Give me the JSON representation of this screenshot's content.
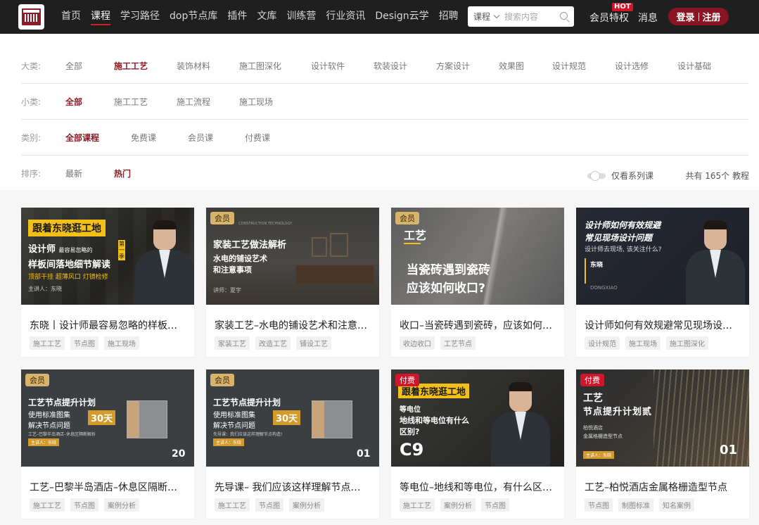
{
  "header": {
    "logo_text": "",
    "nav": [
      "首页",
      "课程",
      "学习路径",
      "dop节点库",
      "插件",
      "文库",
      "训练营",
      "行业资讯",
      "Design云学",
      "招聘"
    ],
    "active_nav": 1,
    "search": {
      "category": "课程",
      "placeholder": "搜索内容"
    },
    "member_label": "会员特权",
    "hot_badge": "HOT",
    "message_label": "消息",
    "login_label": "登录",
    "register_label": "注册"
  },
  "filters": {
    "major": {
      "label": "大类:",
      "options": [
        "全部",
        "施工工艺",
        "装饰材料",
        "施工图深化",
        "设计软件",
        "软装设计",
        "方案设计",
        "效果图",
        "设计规范",
        "设计选修",
        "设计基础"
      ],
      "selected": 1
    },
    "minor": {
      "label": "小类:",
      "options": [
        "全部",
        "施工工艺",
        "施工流程",
        "施工现场"
      ],
      "selected": 0
    },
    "kind": {
      "label": "类别:",
      "options": [
        "全部课程",
        "免费课",
        "会员课",
        "付费课"
      ],
      "selected": 0
    },
    "sort": {
      "label": "排序:",
      "options": [
        "最新",
        "热门"
      ],
      "selected": 1
    },
    "series_only_label": "仅看系列课",
    "total_prefix": "共有 ",
    "total_count": "165",
    "total_suffix": "个 教程"
  },
  "courses": [
    {
      "title": "东晓丨设计师最容易忽略的样板…",
      "tags": [
        "施工工艺",
        "节点图",
        "施工现场"
      ],
      "badge": "",
      "thumb": {
        "line1": "跟着东晓逛工地",
        "line2": "设计师",
        "line2b": "最容易忽略的",
        "line3": "样板间落地细节解读",
        "line4": "顶部干挂  超薄风口  灯镜检修",
        "line5": "主讲人：东晓",
        "seal": "第一季"
      }
    },
    {
      "title": "家装工艺–水电的铺设艺术和注意…",
      "tags": [
        "家装工艺",
        "改造工艺",
        "铺设工艺"
      ],
      "badge": "会员",
      "thumb": {
        "line1": "家装工艺做法解析",
        "line2": "水电的铺设艺术",
        "line3": "和注意事项",
        "line4": "讲师：夏宇",
        "line5": "CONSTRUCTION TECHNOLOGY"
      }
    },
    {
      "title": "收口–当瓷砖遇到瓷砖，应该如何…",
      "tags": [
        "收边收口",
        "工艺节点"
      ],
      "badge": "会员",
      "thumb": {
        "line1": "工艺",
        "line2": "当瓷砖遇到瓷砖",
        "line3": "应该如何收口?"
      }
    },
    {
      "title": "设计师如何有效规避常见现场设…",
      "tags": [
        "设计规范",
        "施工现场",
        "施工图深化"
      ],
      "badge": "",
      "thumb": {
        "line1": "设计师如何有效规避",
        "line2": "常见现场设计问题",
        "line3": "设计师去现场, 该关注什么?",
        "line4": "东晓",
        "line5": "DONGXIAO"
      }
    },
    {
      "title": "工艺–巴黎半岛酒店–休息区隔断…",
      "tags": [
        "施工工艺",
        "节点图",
        "案例分析"
      ],
      "badge": "会员",
      "thumb": {
        "line1": "工艺节点提升计划",
        "line2": "使用标准图集",
        "line3": "解决节点问题",
        "line4": "30天",
        "line5": "工艺–巴黎半岛酒店–休息区隔断解析",
        "num": "20",
        "speaker": "主讲人：东晓"
      }
    },
    {
      "title": "先导课– 我们应该这样理解节点…",
      "tags": [
        "施工工艺",
        "节点图",
        "案例分析"
      ],
      "badge": "会员",
      "thumb": {
        "line1": "工艺节点提升计划",
        "line2": "使用标准图集",
        "line3": "解决节点问题",
        "line4": "30天",
        "line5": "先导课：我们应该这样理解节点构造!",
        "num": "01",
        "speaker": "主讲人：东晓"
      }
    },
    {
      "title": "等电位–地线和等电位，有什么区…",
      "tags": [
        "施工工艺",
        "案例分析",
        "节点图"
      ],
      "badge": "付费",
      "thumb": {
        "line1": "跟着东晓逛工地",
        "line2": "等电位",
        "line3": "地线和等电位有什么",
        "line4": "区别?",
        "num": "C9"
      }
    },
    {
      "title": "工艺–柏悦酒店金属格栅造型节点",
      "tags": [
        "节点图",
        "制图标准",
        "知名案例"
      ],
      "badge": "付费",
      "thumb": {
        "line1": "工艺",
        "line2": "节点提升计划贰",
        "line3": "柏悦酒店",
        "line4": "金属格栅造型节点",
        "num": "01",
        "speaker": "主讲人：东晓"
      }
    }
  ],
  "colors": {
    "header_bg": "#1f1f1f",
    "brand": "#8c1d26",
    "accent_red": "#d0162b",
    "vip_gold": "#d8b46a"
  }
}
